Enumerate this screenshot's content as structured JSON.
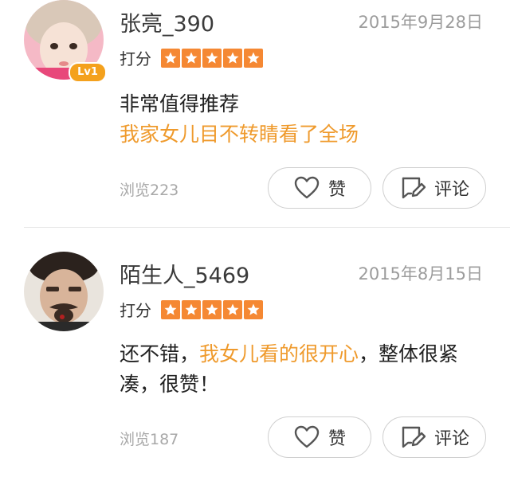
{
  "reviews": [
    {
      "username": "张亮_390",
      "date": "2015年9月28日",
      "level_badge": "Lv1",
      "rating_label": "打分",
      "stars": 5,
      "comment": {
        "line1": "非常值得推荐",
        "line2_highlight": "我家女儿目不转睛看了全场"
      },
      "views": "浏览223",
      "like_label": "赞",
      "comment_label": "评论"
    },
    {
      "username": "陌生人_5469",
      "date": "2015年8月15日",
      "rating_label": "打分",
      "stars": 5,
      "comment": {
        "part1": "还不错，",
        "highlight": "我女儿看的很开心",
        "part2": "，整体很紧凑，很赞！"
      },
      "views": "浏览187",
      "like_label": "赞",
      "comment_label": "评论"
    }
  ],
  "colors": {
    "accent_orange": "#ef9a2c",
    "star_orange": "#f58833",
    "badge_orange": "#f4a11d",
    "muted_gray": "#9c9c9c"
  }
}
